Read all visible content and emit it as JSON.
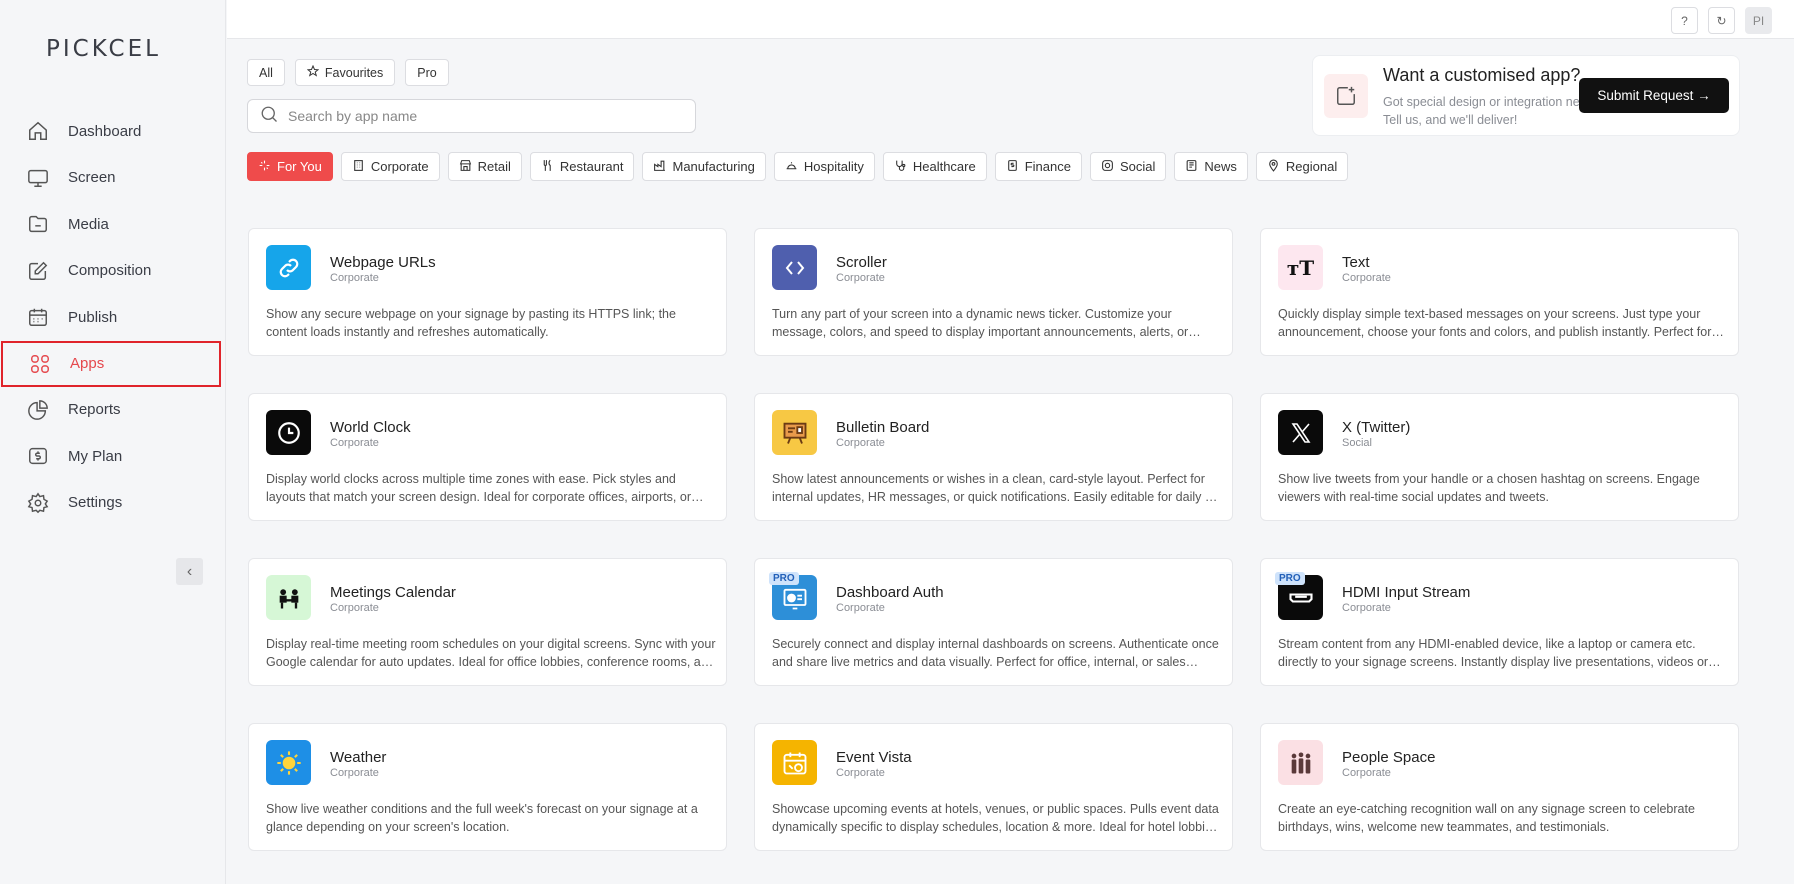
{
  "brand": {
    "logo_text": "PICKCEL"
  },
  "sidebar": {
    "items": [
      {
        "label": "Dashboard",
        "icon": "home-icon"
      },
      {
        "label": "Screen",
        "icon": "monitor-icon"
      },
      {
        "label": "Media",
        "icon": "folder-icon"
      },
      {
        "label": "Composition",
        "icon": "edit-icon"
      },
      {
        "label": "Publish",
        "icon": "calendar-icon"
      },
      {
        "label": "Apps",
        "icon": "grid-icon",
        "active": true
      },
      {
        "label": "Reports",
        "icon": "pie-chart-icon"
      },
      {
        "label": "My Plan",
        "icon": "plan-icon"
      },
      {
        "label": "Settings",
        "icon": "gear-icon"
      }
    ],
    "collapse_glyph": "‹"
  },
  "topbar": {
    "help": "?",
    "refresh": "↻",
    "avatar": "PI"
  },
  "filters": {
    "all": "All",
    "favourites": "Favourites",
    "pro": "Pro"
  },
  "search": {
    "placeholder": "Search by app name"
  },
  "categories": [
    "For You",
    "Corporate",
    "Retail",
    "Restaurant",
    "Manufacturing",
    "Hospitality",
    "Healthcare",
    "Finance",
    "Social",
    "News",
    "Regional"
  ],
  "promo": {
    "title": "Want a customised app?",
    "description": "Got special design or integration needs? Tell us, and we'll deliver!",
    "button": "Submit Request →"
  },
  "apps": [
    {
      "name": "Webpage URLs",
      "category": "Corporate",
      "description": "Show any secure webpage on your signage by pasting its HTTPS link; the content loads instantly and refreshes automatically.",
      "icon": "link-icon",
      "color": "#16a5ea"
    },
    {
      "name": "Scroller",
      "category": "Corporate",
      "description": "Turn any part of your screen into a dynamic news ticker. Customize your message, colors, and speed to display important announcements, alerts, or promotions as they happen.",
      "icon": "code-brackets-icon",
      "color": "#4f5fae"
    },
    {
      "name": "Text",
      "category": "Corporate",
      "description": "Quickly display simple text-based messages on your screens. Just type your announcement, choose your fonts and colors, and publish instantly. Perfect for updates.",
      "icon": "text-icon",
      "color": "#fde7ef"
    },
    {
      "name": "World Clock",
      "category": "Corporate",
      "description": "Display world clocks across multiple time zones with ease. Pick styles and layouts that match your screen design. Ideal for corporate offices, airports, or newsrooms.",
      "icon": "clock-icon",
      "color": "#0a0a0a"
    },
    {
      "name": "Bulletin Board",
      "category": "Corporate",
      "description": "Show latest announcements or wishes in a clean, card-style layout. Perfect for internal updates, HR messages, or quick notifications. Easily editable for daily or weekly use.",
      "icon": "bulletin-icon",
      "color": "#f7c844"
    },
    {
      "name": "X (Twitter)",
      "category": "Social",
      "description": "Show live tweets from your handle or a chosen hashtag on screens. Engage viewers with real-time social updates and tweets.",
      "icon": "x-logo-icon",
      "color": "#0a0a0a"
    },
    {
      "name": "Meetings Calendar",
      "category": "Corporate",
      "description": "Display real-time meeting room schedules on your digital screens. Sync with your Google calendar for auto updates. Ideal for office lobbies, conference rooms, and more.",
      "icon": "meeting-icon",
      "color": "#d6f7d6"
    },
    {
      "name": "Dashboard Auth",
      "category": "Corporate",
      "description": "Securely connect and display internal dashboards on screens. Authenticate once and share live metrics and data visually. Perfect for office, internal, or sales teams.",
      "icon": "dashboard-icon",
      "color": "#2d8fd8",
      "pro": "PRO"
    },
    {
      "name": "HDMI Input Stream",
      "category": "Corporate",
      "description": "Stream content from any HDMI-enabled device, like a laptop or camera etc. directly to your signage screens. Instantly display live presentations, videos or feeds.",
      "icon": "hdmi-icon",
      "color": "#0a0a0a",
      "pro": "PRO"
    },
    {
      "name": "Weather",
      "category": "Corporate",
      "description": "Show live weather conditions and the full week's forecast on your signage at a glance depending on your screen's location.",
      "icon": "weather-icon",
      "color": "#1e8fe6"
    },
    {
      "name": "Event Vista",
      "category": "Corporate",
      "description": "Showcase upcoming events at hotels, venues, or public spaces. Pulls event data dynamically specific to display schedules, location & more. Ideal for hotel lobbies, venues.",
      "icon": "event-icon",
      "color": "#f5b400"
    },
    {
      "name": "People Space",
      "category": "Corporate",
      "description": "Create an eye-catching recognition wall on any signage screen to celebrate birthdays, wins, welcome new teammates, and testimonials.",
      "icon": "people-icon",
      "color": "#fbe0e4"
    }
  ]
}
